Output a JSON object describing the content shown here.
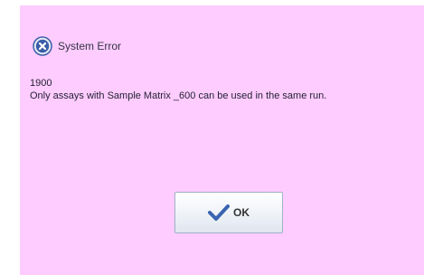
{
  "dialog": {
    "title": "System Error",
    "error_code": "1900",
    "message": "Only assays with Sample Matrix _600 can be used in the same run.",
    "ok_label": "OK",
    "icons": {
      "error": "error-circle-x-icon",
      "ok": "checkmark-icon"
    },
    "colors": {
      "background": "#ffccff",
      "error_icon": "#3b5ea8",
      "checkmark": "#3a64b0"
    }
  }
}
